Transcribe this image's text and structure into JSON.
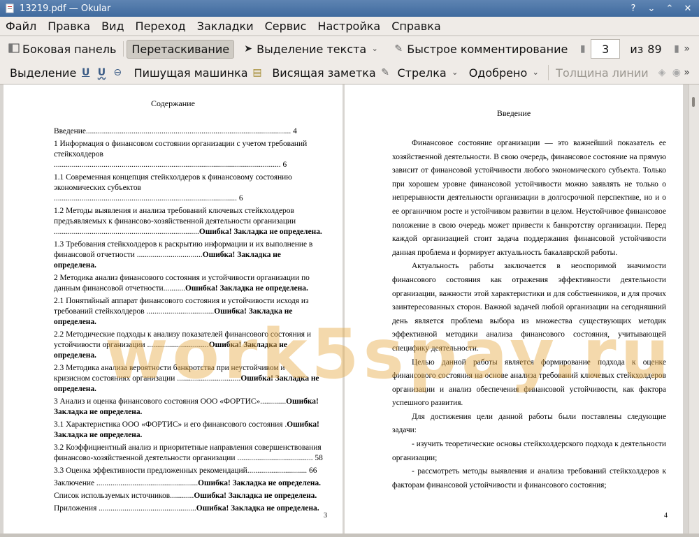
{
  "window": {
    "title": "13219.pdf — Okular"
  },
  "menu": [
    "Файл",
    "Правка",
    "Вид",
    "Переход",
    "Закладки",
    "Сервис",
    "Настройка",
    "Справка"
  ],
  "toolbar1": {
    "sidebar": "Боковая панель",
    "drag": "Перетаскивание",
    "text_select": "Выделение текста",
    "quick_comment": "Быстрое комментирование",
    "page_current": "3",
    "page_of": "из",
    "page_total": "89"
  },
  "toolbar2": {
    "selection": "Выделение",
    "typewriter": "Пишущая машинка",
    "sticky": "Висящая заметка",
    "arrow": "Стрелка",
    "approved": "Одобрено",
    "line_width": "Толщина линии"
  },
  "left_page": {
    "title": "Содержание",
    "number": "3",
    "toc": [
      {
        "text": "Введение.......................................................................................................",
        "page": "4",
        "error": ""
      },
      {
        "text": "1 Информация о финансовом состоянии организации с учетом требований стейкхолдеров ..................................................................................................................",
        "page": "6",
        "error": ""
      },
      {
        "text": "1.1 Современная концепция стейкхолдеров к финансовому состоянию экономических субъектов ............................................................................................",
        "page": "6",
        "error": ""
      },
      {
        "text": "1.2 Методы выявления и анализа требований ключевых стейкхолдеров предъявляемых к финансово-хозяйственной деятельности организации .........................................................................",
        "page": "",
        "error": "Ошибка! Закладка не определена."
      },
      {
        "text": "1.3 Требования стейкхолдеров к раскрытию информации и их выполнение в финансовой отчетности .................................",
        "page": "",
        "error": "Ошибка! Закладка не определена."
      },
      {
        "text": "2 Методика анализ финансового состояния и устойчивости организации по данным финансовой отчетности...........",
        "page": "",
        "error": "Ошибка! Закладка не определена."
      },
      {
        "text": "2.1 Понятийный аппарат финансового состояния и устойчивости исходя из требований стейкхолдеров ..................................",
        "page": "",
        "error": "Ошибка! Закладка не определена."
      },
      {
        "text": "2.2 Методические подходы к анализу показателей финансового состояния и устойчивости организации ...............................",
        "page": "",
        "error": "Ошибка! Закладка не определена."
      },
      {
        "text": "2.3 Методика анализа вероятности банкротства при неустойчивом и кризисном состояниях организации ................................",
        "page": "",
        "error": "Ошибка! Закладка не определена."
      },
      {
        "text": "3 Анализ и оценка финансового состояния ООО «ФОРТИС».............",
        "page": "",
        "error": "Ошибка! Закладка не определена."
      },
      {
        "text": "3.1 Характеристика ООО «ФОРТИС» и его финансового состояния .",
        "page": "",
        "error": "Ошибка! Закладка не определена."
      },
      {
        "text": "3.2 Коэффициентный анализ и приоритетные направления совершенствования финансово-хозяйственной деятельности организации ......................................",
        "page": "58",
        "error": ""
      },
      {
        "text": "3.3 Оценка эффективности предложенных рекомендаций..............................",
        "page": "66",
        "error": ""
      },
      {
        "text": "Заключение ...................................................",
        "page": "",
        "error": "Ошибка! Закладка не определена."
      },
      {
        "text": "Список используемых источников............",
        "page": "",
        "error": "Ошибка! Закладка не определена."
      },
      {
        "text": "Приложения .................................................",
        "page": "",
        "error": "Ошибка! Закладка не определена."
      }
    ]
  },
  "right_page": {
    "title": "Введение",
    "number": "4",
    "paragraphs": [
      "Финансовое состояние организации — это важнейший показатель ее хозяйственной деятельности. В свою очередь, финансовое состояние на прямую зависит от финансовой устойчивости любого экономического субъекта. Только при хорошем уровне финансовой устойчивости можно заявлять не только о непрерывности деятельности организации в долгосрочной перспективе, но и о ее органичном росте и устойчивом развитии в целом. Неустойчивое финансовое положение в свою очередь может привести к банкротству организации. Перед каждой организацией стоит задача поддержания финансовой устойчивости данная проблема и формирует актуальность бакалаврской работы.",
      "Актуальность работы заключается в неоспоримой значимости финансового состояния как отражения эффективности деятельности организации, важности этой характеристики и для собственников, и для прочих заинтересованных сторон. Важной задачей любой организации на сегодняшний день является проблема выбора из множества существующих методик эффективной методики анализа финансового состояния, учитывающей специфику деятельности.",
      "Целью данной работы является формирование подхода к оценке финансового состояния на основе анализа требований ключевых стейкхолдеров организации и анализ обеспечения финансовой устойчивости, как фактора успешного развития.",
      "Для достижения цели данной работы были поставлены следующие задачи:",
      "- изучить теоретические основы стейкхолдерского подхода к деятельности организации;",
      "- рассмотреть методы выявления и анализа требований стейкхолдеров к факторам финансовой устойчивости и финансового состояния;"
    ]
  },
  "watermark": "work5spay.ru"
}
